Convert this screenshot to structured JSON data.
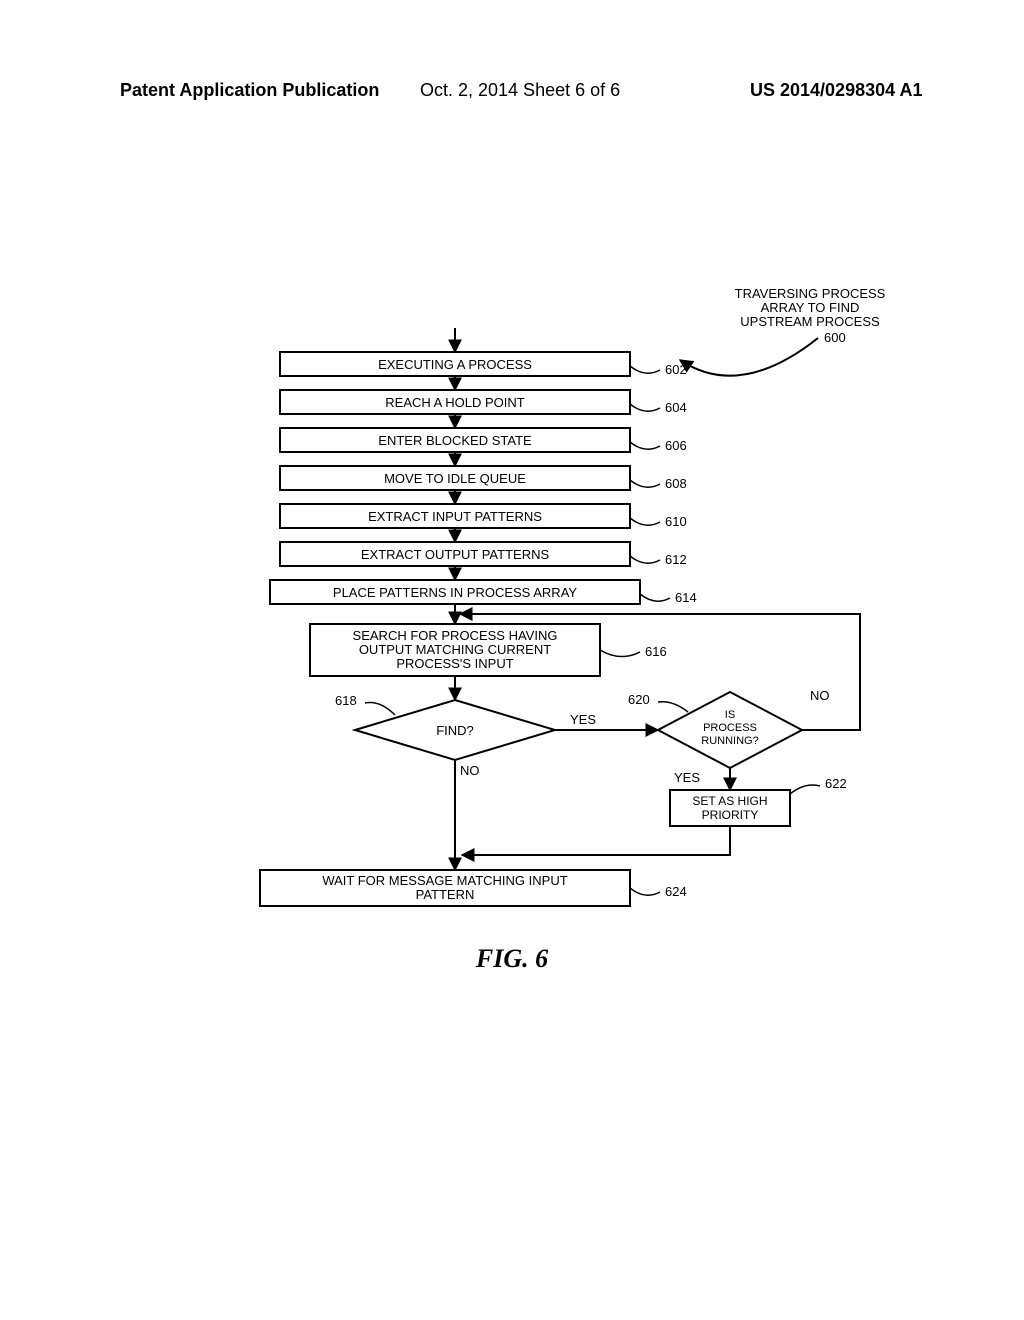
{
  "header": {
    "left": "Patent Application Publication",
    "center": "Oct. 2, 2014   Sheet 6 of 6",
    "right": "US 2014/0298304 A1"
  },
  "diagram": {
    "title_header": {
      "l1": "TRAVERSING PROCESS",
      "l2": "ARRAY TO FIND",
      "l3": "UPSTREAM PROCESS"
    },
    "title_ref": "600",
    "steps": {
      "s602": {
        "label": "EXECUTING A PROCESS",
        "ref": "602"
      },
      "s604": {
        "label": "REACH A HOLD POINT",
        "ref": "604"
      },
      "s606": {
        "label": "ENTER BLOCKED STATE",
        "ref": "606"
      },
      "s608": {
        "label": "MOVE TO IDLE QUEUE",
        "ref": "608"
      },
      "s610": {
        "label": "EXTRACT INPUT PATTERNS",
        "ref": "610"
      },
      "s612": {
        "label": "EXTRACT OUTPUT PATTERNS",
        "ref": "612"
      },
      "s614": {
        "label": "PLACE PATTERNS IN PROCESS ARRAY",
        "ref": "614"
      },
      "s616": {
        "l1": "SEARCH FOR PROCESS HAVING",
        "l2": "OUTPUT MATCHING CURRENT",
        "l3": "PROCESS'S INPUT",
        "ref": "616"
      },
      "d618": {
        "label": "FIND?",
        "ref": "618",
        "yes": "YES",
        "no": "NO"
      },
      "d620": {
        "l1": "IS",
        "l2": "PROCESS",
        "l3": "RUNNING?",
        "ref": "620",
        "yes": "YES",
        "no": "NO"
      },
      "s622": {
        "l1": "SET AS HIGH",
        "l2": "PRIORITY",
        "ref": "622"
      },
      "s624": {
        "l1": "WAIT FOR MESSAGE MATCHING INPUT",
        "l2": "PATTERN",
        "ref": "624"
      }
    }
  },
  "figure_caption": "FIG. 6"
}
